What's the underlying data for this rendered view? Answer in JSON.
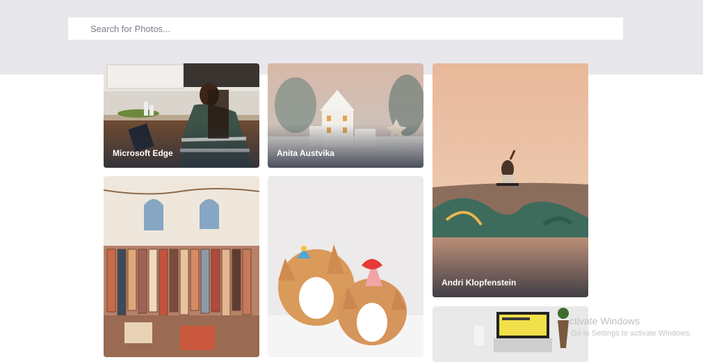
{
  "search": {
    "placeholder": "Search for Photos..."
  },
  "photos": [
    {
      "author": "Microsoft Edge",
      "depicts": "woman-laptop-kitchen"
    },
    {
      "author": "Anita Austvika",
      "depicts": "snowy-house-ornament"
    },
    {
      "author": "Andri Klopfenstein",
      "depicts": "skateboarder-mural-wall"
    },
    {
      "author": "",
      "depicts": "market-textiles-wall"
    },
    {
      "author": "",
      "depicts": "corgis-birthday"
    },
    {
      "author": "",
      "depicts": "laptop-desk-plant"
    }
  ],
  "watermark": {
    "line1": "ctivate Windows",
    "line2": "Go to Settings to activate Windows."
  }
}
